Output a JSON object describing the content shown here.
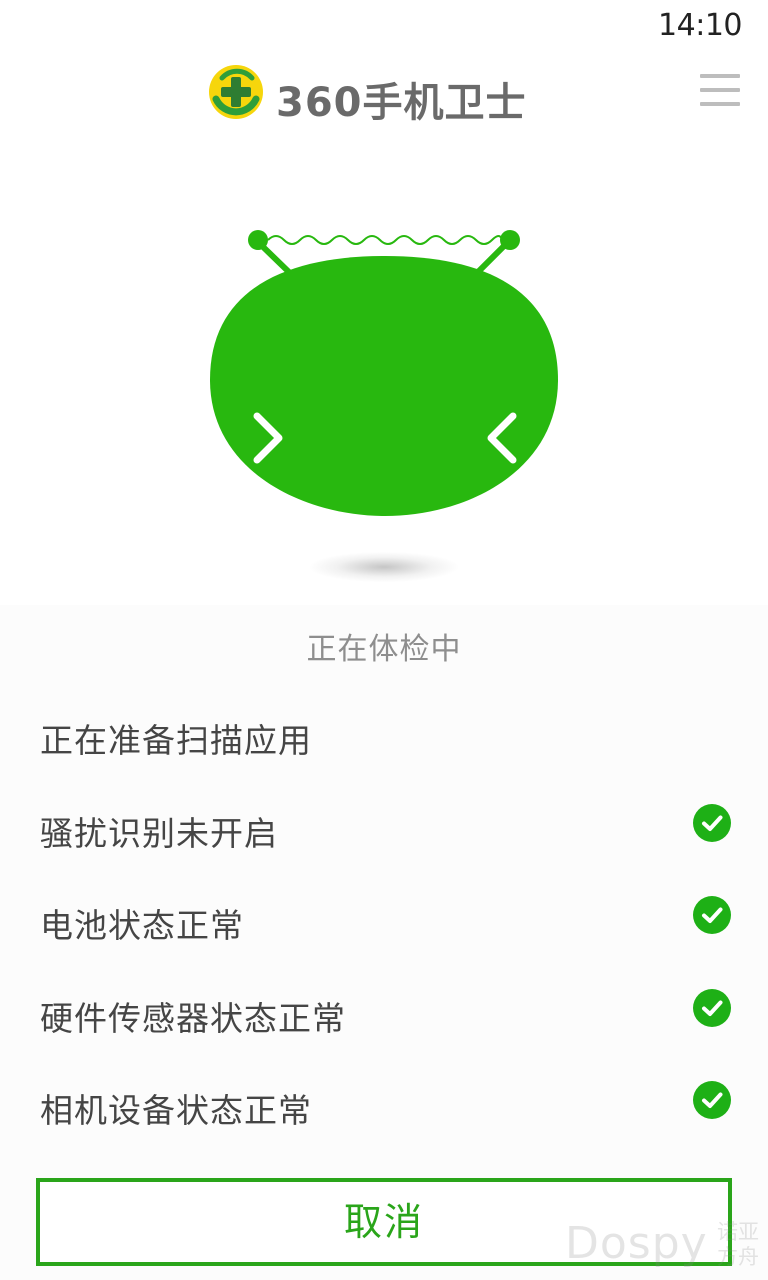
{
  "status_bar": {
    "time": "14:10"
  },
  "header": {
    "brand_name": "360手机卫士",
    "logo_icon": "360-shield-plus-icon",
    "menu_icon": "hamburger-menu-icon"
  },
  "mascot": {
    "icon": "green-robot-mascot-icon",
    "colors": {
      "body": "#28b80f",
      "eyes": "#ffffff"
    }
  },
  "scan": {
    "status_text": "正在体检中"
  },
  "check_items": [
    {
      "label": "正在准备扫描应用",
      "checked": false
    },
    {
      "label": "骚扰识别未开启",
      "checked": true
    },
    {
      "label": "电池状态正常",
      "checked": true
    },
    {
      "label": "硬件传感器状态正常",
      "checked": true
    },
    {
      "label": "相机设备状态正常",
      "checked": true
    }
  ],
  "actions": {
    "cancel_label": "取消"
  },
  "watermark": {
    "latin": "Dospy",
    "cjk": "诺亚方舟"
  },
  "colors": {
    "accent_green": "#2aa51a",
    "check_green": "#1eb016",
    "logo_yellow": "#f6d60c"
  }
}
